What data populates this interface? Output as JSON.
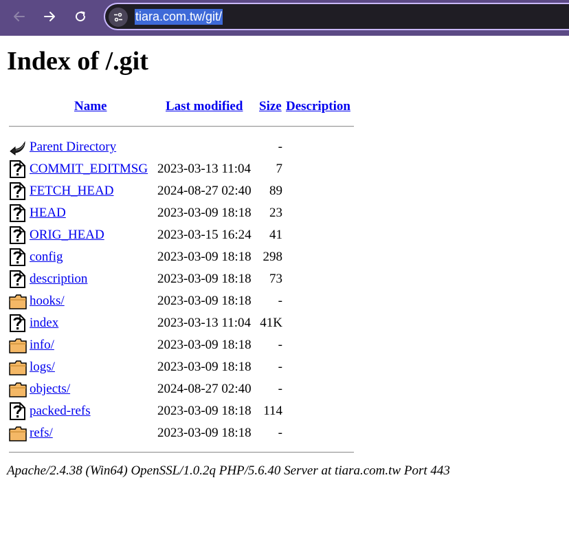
{
  "browser": {
    "url": "tiara.com.tw/git/",
    "icons": {
      "back": "arrow-left-icon",
      "forward": "arrow-right-icon",
      "reload": "reload-icon",
      "site_info": "tune-icon"
    },
    "colors": {
      "toolbar": "#5c4a85",
      "omnibox": "#1f1d24",
      "url_highlight": "#3e6ad8"
    }
  },
  "page": {
    "title": "Index of /.git",
    "headers": {
      "name": "Name",
      "last_modified": "Last modified",
      "size": "Size",
      "description": "Description"
    },
    "entries": [
      {
        "icon": "back-icon",
        "name": "Parent Directory",
        "modified": "",
        "size": "-"
      },
      {
        "icon": "unknown-file-icon",
        "name": "COMMIT_EDITMSG",
        "modified": "2023-03-13 11:04",
        "size": "7"
      },
      {
        "icon": "unknown-file-icon",
        "name": "FETCH_HEAD",
        "modified": "2024-08-27 02:40",
        "size": "89"
      },
      {
        "icon": "unknown-file-icon",
        "name": "HEAD",
        "modified": "2023-03-09 18:18",
        "size": "23"
      },
      {
        "icon": "unknown-file-icon",
        "name": "ORIG_HEAD",
        "modified": "2023-03-15 16:24",
        "size": "41"
      },
      {
        "icon": "unknown-file-icon",
        "name": "config",
        "modified": "2023-03-09 18:18",
        "size": "298"
      },
      {
        "icon": "unknown-file-icon",
        "name": "description",
        "modified": "2023-03-09 18:18",
        "size": "73"
      },
      {
        "icon": "folder-icon",
        "name": "hooks/",
        "modified": "2023-03-09 18:18",
        "size": "-"
      },
      {
        "icon": "unknown-file-icon",
        "name": "index",
        "modified": "2023-03-13 11:04",
        "size": "41K"
      },
      {
        "icon": "folder-icon",
        "name": "info/",
        "modified": "2023-03-09 18:18",
        "size": "-"
      },
      {
        "icon": "folder-icon",
        "name": "logs/",
        "modified": "2023-03-09 18:18",
        "size": "-"
      },
      {
        "icon": "folder-icon",
        "name": "objects/",
        "modified": "2024-08-27 02:40",
        "size": "-"
      },
      {
        "icon": "unknown-file-icon",
        "name": "packed-refs",
        "modified": "2023-03-09 18:18",
        "size": "114"
      },
      {
        "icon": "folder-icon",
        "name": "refs/",
        "modified": "2023-03-09 18:18",
        "size": "-"
      }
    ],
    "footer": "Apache/2.4.38 (Win64) OpenSSL/1.0.2q PHP/5.6.40 Server at tiara.com.tw Port 443",
    "colors": {
      "link": "#0000ee",
      "folder": "#f4b866"
    }
  }
}
